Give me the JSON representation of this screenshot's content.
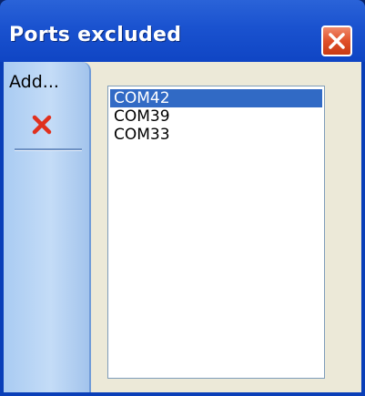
{
  "window": {
    "title": "Ports excluded",
    "close_icon": "close-icon"
  },
  "sidepanel": {
    "add_label": "Add...",
    "delete_icon": "red-x-delete-icon"
  },
  "ports": {
    "items": [
      "COM42",
      "COM39",
      "COM33"
    ],
    "selected_index": 0
  },
  "colors": {
    "titlebar": "#1a52cf",
    "selection": "#316ac5",
    "close_button": "#e0502a",
    "delete_icon": "#e0301e",
    "client_background": "#ece9d8"
  }
}
